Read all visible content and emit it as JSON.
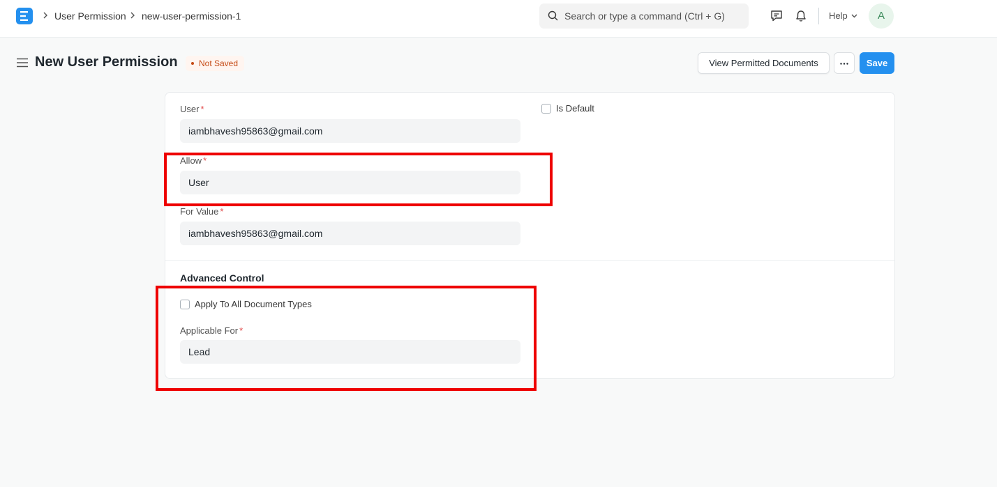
{
  "navbar": {
    "breadcrumbs": [
      "User Permission",
      "new-user-permission-1"
    ],
    "search_placeholder": "Search or type a command (Ctrl + G)",
    "help_label": "Help",
    "avatar_initial": "A",
    "icons": [
      "app-logo-icon",
      "chat-icon",
      "bell-icon",
      "search-icon"
    ]
  },
  "page": {
    "title": "New User Permission",
    "status": "Not Saved",
    "view_permitted_label": "View Permitted Documents",
    "save_label": "Save"
  },
  "form": {
    "user": {
      "label": "User",
      "value": "iambhavesh95863@gmail.com"
    },
    "is_default": {
      "label": "Is Default"
    },
    "allow": {
      "label": "Allow",
      "value": "User"
    },
    "for_value": {
      "label": "For Value",
      "value": "iambhavesh95863@gmail.com"
    },
    "advanced_section_title": "Advanced Control",
    "apply_to_all": {
      "label": "Apply To All Document Types"
    },
    "applicable_for": {
      "label": "Applicable For",
      "value": "Lead"
    },
    "required_marker": "*"
  },
  "colors": {
    "accent": "#2490ef",
    "required": "#e24c4c",
    "status_text": "#c54a14",
    "highlight": "#ee0000"
  }
}
